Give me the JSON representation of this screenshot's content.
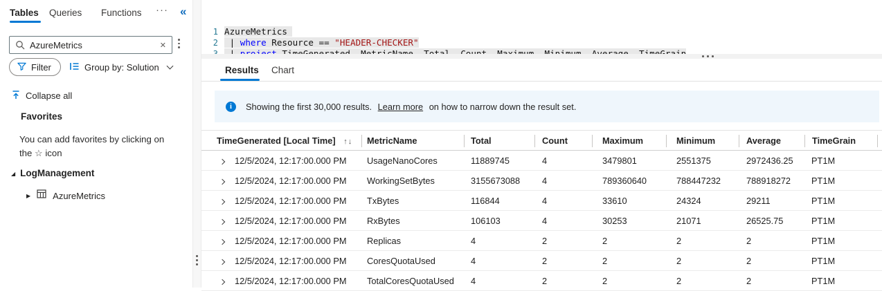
{
  "colors": {
    "accent": "#0078d4",
    "banner_bg": "#eff6fc",
    "code_keyword": "#0000ff",
    "code_string": "#a31515",
    "tab_underline": "#0078d4"
  },
  "icons": {
    "more": "···",
    "collapse_pane": "«",
    "clear": "✕",
    "star": "☆",
    "sort": "↑↓",
    "tree_expanded": "◢",
    "tree_collapsed": "▶",
    "info": "i"
  },
  "sidebar": {
    "tabs": [
      {
        "label": "Tables"
      },
      {
        "label": "Queries"
      },
      {
        "label": "Functions"
      }
    ],
    "search": {
      "value": "AzureMetrics"
    },
    "filter_label": "Filter",
    "group_by_label": "Group by: Solution",
    "collapse_all_label": "Collapse all",
    "favorites_title": "Favorites",
    "favorites_hint_line1": "You can add favorites by clicking on",
    "favorites_hint_line2_pre": "the",
    "favorites_hint_line2_post": "icon",
    "tree": {
      "group_label": "LogManagement",
      "items": [
        {
          "label": "AzureMetrics"
        }
      ]
    }
  },
  "editor": {
    "lines": [
      {
        "number": "1",
        "pad": true,
        "tokens": [
          {
            "t": "AzureMetrics",
            "c": "plain"
          }
        ]
      },
      {
        "number": "2",
        "pad": false,
        "tokens": [
          {
            "t": " | ",
            "c": "plain"
          },
          {
            "t": "where",
            "c": "keyword"
          },
          {
            "t": " Resource == ",
            "c": "plain"
          },
          {
            "t": "\"HEADER-CHECKER\"",
            "c": "string"
          }
        ]
      },
      {
        "number": "3",
        "pad": false,
        "tokens": [
          {
            "t": " | ",
            "c": "plain"
          },
          {
            "t": "project",
            "c": "keyword"
          },
          {
            "t": " TimeGenerated, MetricName, Total, Count, Maximum, Minimum, Average, TimeGrain",
            "c": "plain"
          }
        ]
      }
    ]
  },
  "results": {
    "tabs": [
      {
        "label": "Results"
      },
      {
        "label": "Chart"
      }
    ],
    "banner": {
      "text_before": "Showing the first 30,000 results.",
      "link_label": "Learn more",
      "text_after": "on how to narrow down the result set."
    },
    "table": {
      "columns": [
        "TimeGenerated [Local Time]",
        "MetricName",
        "Total",
        "Count",
        "Maximum",
        "Minimum",
        "Average",
        "TimeGrain"
      ],
      "column_keys": [
        "timegenerated",
        "metricname",
        "total",
        "count",
        "maximum",
        "minimum",
        "average",
        "timegrain"
      ],
      "rows": [
        [
          "12/5/2024, 12:17:00.000 PM",
          "UsageNanoCores",
          "11889745",
          "4",
          "3479801",
          "2551375",
          "2972436.25",
          "PT1M"
        ],
        [
          "12/5/2024, 12:17:00.000 PM",
          "WorkingSetBytes",
          "3155673088",
          "4",
          "789360640",
          "788447232",
          "788918272",
          "PT1M"
        ],
        [
          "12/5/2024, 12:17:00.000 PM",
          "TxBytes",
          "116844",
          "4",
          "33610",
          "24324",
          "29211",
          "PT1M"
        ],
        [
          "12/5/2024, 12:17:00.000 PM",
          "RxBytes",
          "106103",
          "4",
          "30253",
          "21071",
          "26525.75",
          "PT1M"
        ],
        [
          "12/5/2024, 12:17:00.000 PM",
          "Replicas",
          "4",
          "2",
          "2",
          "2",
          "2",
          "PT1M"
        ],
        [
          "12/5/2024, 12:17:00.000 PM",
          "CoresQuotaUsed",
          "4",
          "2",
          "2",
          "2",
          "2",
          "PT1M"
        ],
        [
          "12/5/2024, 12:17:00.000 PM",
          "TotalCoresQuotaUsed",
          "4",
          "2",
          "2",
          "2",
          "2",
          "PT1M"
        ]
      ]
    }
  }
}
